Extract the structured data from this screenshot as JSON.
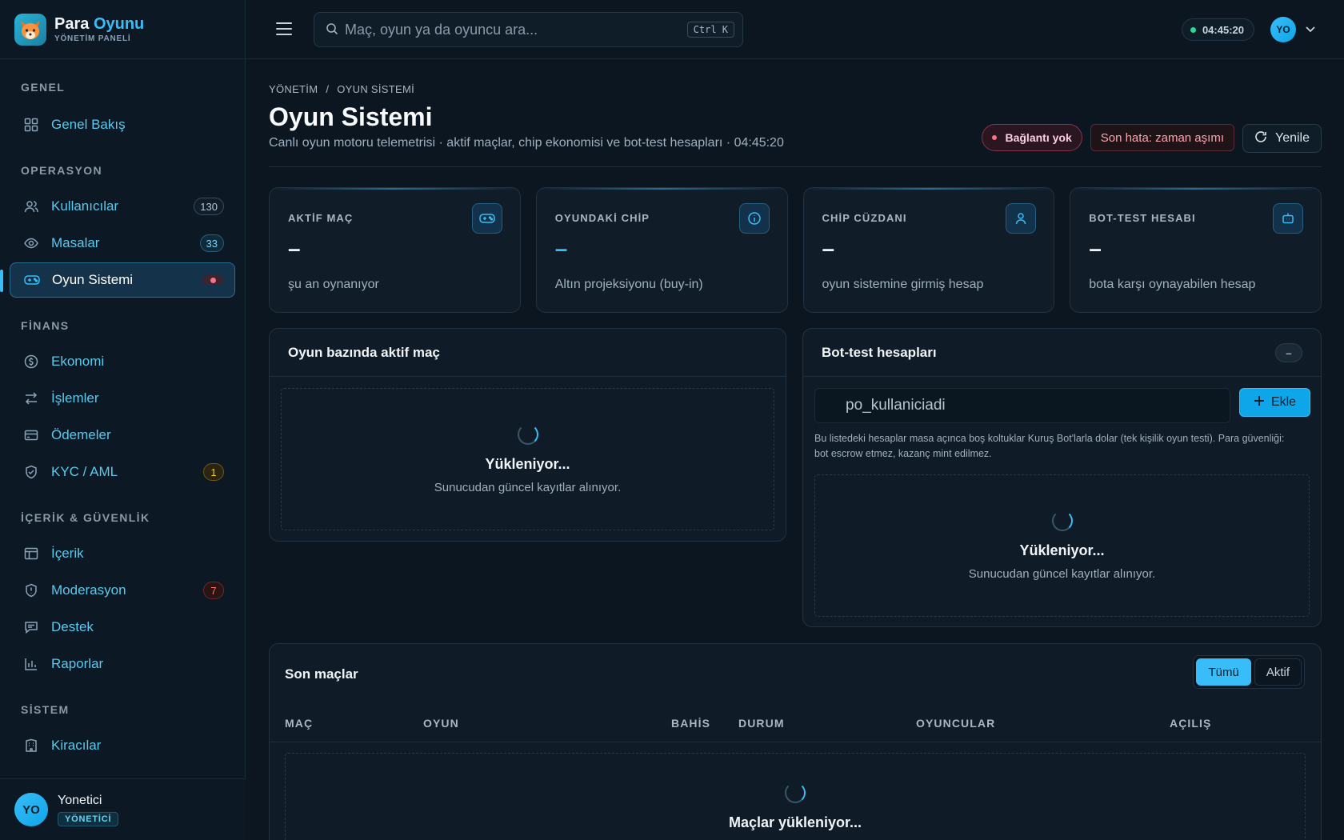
{
  "brand": {
    "name_part1": "Para",
    "name_part2": "Oyunu",
    "subtitle": "YÖNETİM PANELİ"
  },
  "sidebar": {
    "sections": {
      "general": "GENEL",
      "operations": "OPERASYON",
      "finance": "FİNANS",
      "content": "İÇERİK & GÜVENLİK",
      "system": "SİSTEM"
    },
    "items": {
      "overview": {
        "label": "Genel Bakış",
        "icon": "grid-icon"
      },
      "users": {
        "label": "Kullanıcılar",
        "badge": "130",
        "icon": "users-icon"
      },
      "tables": {
        "label": "Masalar",
        "badge": "33",
        "icon": "eye-icon"
      },
      "game_system": {
        "label": "Oyun Sistemi",
        "icon": "gamepad-icon",
        "active": true
      },
      "economy": {
        "label": "Ekonomi",
        "icon": "coin-icon"
      },
      "transactions": {
        "label": "İşlemler",
        "icon": "arrows-icon"
      },
      "payments": {
        "label": "Ödemeler",
        "icon": "card-icon"
      },
      "kyc": {
        "label": "KYC / AML",
        "badge": "1",
        "icon": "shield-check-icon"
      },
      "content": {
        "label": "İçerik",
        "icon": "layout-icon"
      },
      "moderation": {
        "label": "Moderasyon",
        "badge": "7",
        "icon": "shield-icon"
      },
      "support": {
        "label": "Destek",
        "icon": "chat-icon"
      },
      "reports": {
        "label": "Raporlar",
        "icon": "bar-chart-icon"
      },
      "tenants": {
        "label": "Kiracılar",
        "icon": "building-icon"
      }
    },
    "user": {
      "initials": "YO",
      "name": "Yonetici",
      "role": "YÖNETİCİ"
    }
  },
  "topbar": {
    "search_placeholder": "Maç, oyun ya da oyuncu ara...",
    "shortcut": "Ctrl K",
    "clock": "04:45:20",
    "avatar_initials": "YO"
  },
  "page": {
    "breadcrumb_root": "YÖNETİM",
    "breadcrumb_sep": "/",
    "breadcrumb_current": "OYUN SİSTEMİ",
    "title": "Oyun Sistemi",
    "subtitle": "Canlı oyun motoru telemetrisi · aktif maçlar, chip ekonomisi ve bot-test hesapları · 04:45:20",
    "status_badge": "Bağlantı yok",
    "error_badge": "Son hata: zaman aşımı",
    "refresh_label": "Yenile"
  },
  "stats": [
    {
      "label": "AKTİF MAÇ",
      "value": "–",
      "desc": "şu an oynanıyor",
      "icon": "gamepad-icon"
    },
    {
      "label": "OYUNDAKİ CHİP",
      "value": "–",
      "desc": "Altın projeksiyonu (buy-in)",
      "icon": "info-icon"
    },
    {
      "label": "CHİP CÜZDANI",
      "value": "–",
      "desc": "oyun sistemine girmiş hesap",
      "icon": "user-icon"
    },
    {
      "label": "BOT-TEST HESABI",
      "value": "–",
      "desc": "bota karşı oynayabilen hesap",
      "icon": "bot-icon"
    }
  ],
  "active_games_panel": {
    "title": "Oyun bazında aktif maç",
    "loading_title": "Yükleniyor...",
    "loading_sub": "Sunucudan güncel kayıtlar alınıyor."
  },
  "bot_panel": {
    "title": "Bot-test hesapları",
    "count": "–",
    "input_placeholder": "po_kullaniciadi",
    "add_label": "Ekle",
    "help": "Bu listedeki hesaplar masa açınca boş koltuklar Kuruş Bot'larla dolar (tek kişilik oyun testi). Para güvenliği: bot escrow etmez, kazanç mint edilmez.",
    "loading_title": "Yükleniyor...",
    "loading_sub": "Sunucudan güncel kayıtlar alınıyor."
  },
  "matches_panel": {
    "title": "Son maçlar",
    "filter_all": "Tümü",
    "filter_active": "Aktif",
    "columns": [
      "MAÇ",
      "OYUN",
      "BAHİS",
      "DURUM",
      "OYUNCULAR",
      "AÇILIŞ"
    ],
    "loading_title": "Maçlar yükleniyor..."
  },
  "colors": {
    "accent": "#38bdf8",
    "background": "#0b1620",
    "danger": "#fb7185",
    "success": "#34d399"
  }
}
